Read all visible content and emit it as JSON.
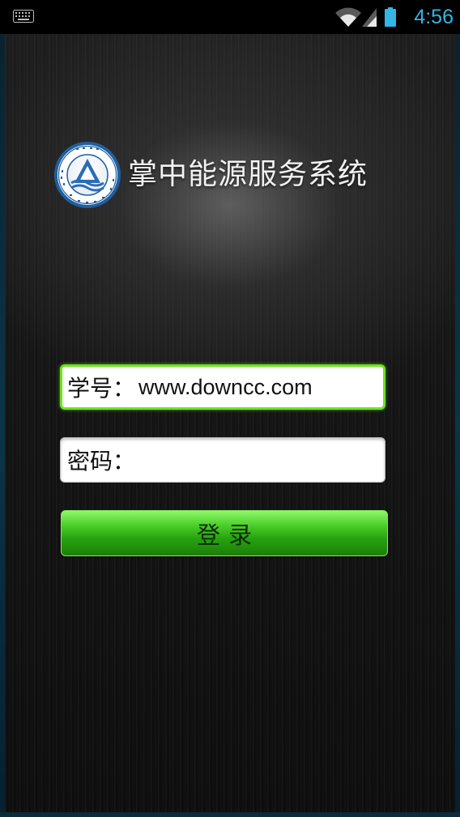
{
  "status_bar": {
    "time": "4:56",
    "icons": [
      "keyboard-icon",
      "wifi-icon",
      "signal-icon",
      "battery-icon"
    ],
    "accent_color": "#33b5e5"
  },
  "app": {
    "title": "掌中能源服务系统",
    "logo_icon": "university-logo-icon"
  },
  "form": {
    "username_label": "学号：",
    "username_value": "www.downcc.com",
    "password_label": "密码：",
    "password_value": "",
    "login_label": "登录",
    "focus_color": "#6ee21f",
    "button_color": "#2aa812"
  }
}
